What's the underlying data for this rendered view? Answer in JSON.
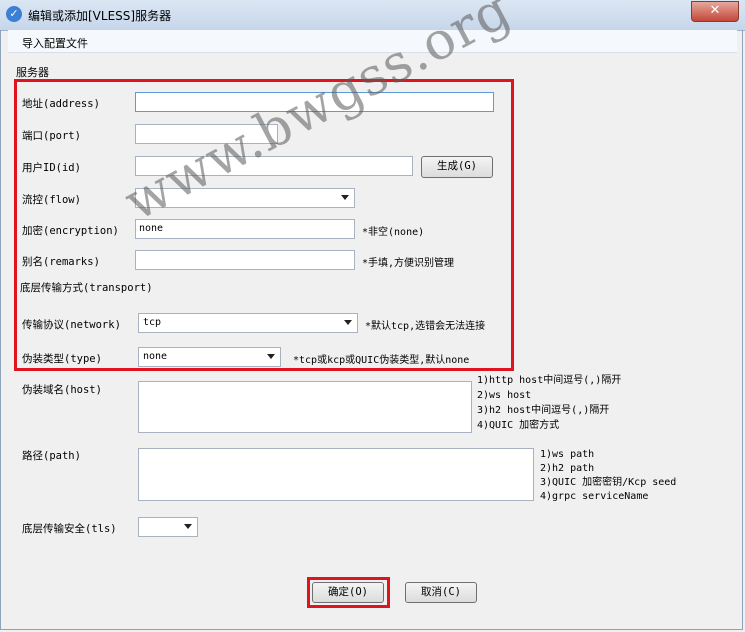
{
  "window": {
    "title": "编辑或添加[VLESS]服务器",
    "close_label": "✕"
  },
  "menu": {
    "import_config": "导入配置文件"
  },
  "server_group": {
    "title": "服务器"
  },
  "fields": {
    "address": {
      "label": "地址(address)",
      "value": ""
    },
    "port": {
      "label": "端口(port)",
      "value": ""
    },
    "id": {
      "label": "用户ID(id)",
      "value": "",
      "generate_button": "生成(G)"
    },
    "flow": {
      "label": "流控(flow)",
      "value": ""
    },
    "encryption": {
      "label": "加密(encryption)",
      "value": "none",
      "hint": "*非空(none)"
    },
    "remarks": {
      "label": "别名(remarks)",
      "value": "",
      "hint": "*手填,方便识别管理"
    }
  },
  "transport_group": {
    "title": "底层传输方式(transport)"
  },
  "transport": {
    "network": {
      "label": "传输协议(network)",
      "value": "tcp",
      "hint": "*默认tcp,选错会无法连接"
    },
    "type": {
      "label": "伪装类型(type)",
      "value": "none",
      "hint": "*tcp或kcp或QUIC伪装类型,默认none"
    },
    "host": {
      "label": "伪装域名(host)",
      "value": "",
      "hints": [
        "1)http host中间逗号(,)隔开",
        "2)ws host",
        "3)h2 host中间逗号(,)隔开",
        "4)QUIC 加密方式"
      ]
    },
    "path": {
      "label": "路径(path)",
      "value": "",
      "hints": [
        "1)ws path",
        "2)h2 path",
        "3)QUIC 加密密钥/Kcp seed",
        "4)grpc serviceName"
      ]
    },
    "tls": {
      "label": "底层传输安全(tls)",
      "value": ""
    }
  },
  "buttons": {
    "ok": "确定(O)",
    "cancel": "取消(C)"
  },
  "watermark": "www.bwgss.org",
  "colors": {
    "highlight": "#e0141e",
    "focus_border": "#5e9ad6"
  }
}
